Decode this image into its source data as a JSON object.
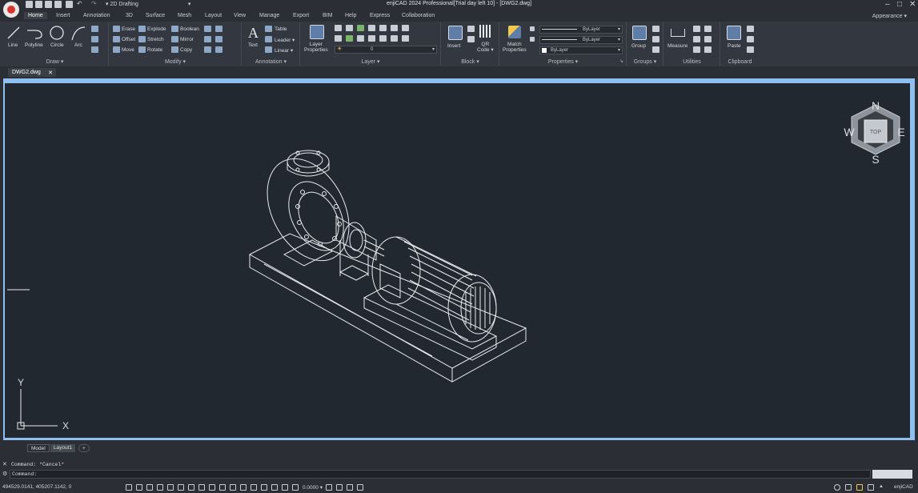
{
  "window": {
    "title": "enjiCAD 2024 Professional[Trial day left 10] - [DWG2.dwg]",
    "workspace": "2D Drafting",
    "appearance": "Appearance"
  },
  "menu_tabs": [
    "Home",
    "Insert",
    "Annotation",
    "3D",
    "Surface",
    "Mesh",
    "Layout",
    "View",
    "Manage",
    "Export",
    "BIM",
    "Help",
    "Express",
    "Collaboration"
  ],
  "ribbon": {
    "draw": {
      "label": "Draw",
      "tools": [
        "Line",
        "Polyline",
        "Circle",
        "Arc"
      ]
    },
    "modify": {
      "label": "Modify",
      "rows": [
        [
          "Erase",
          "Explode",
          "Boolean"
        ],
        [
          "Offset",
          "Stretch",
          "Mirror"
        ],
        [
          "Move",
          "Rotate",
          "Copy"
        ]
      ]
    },
    "annotation": {
      "label": "Annotation",
      "text": "Text",
      "table": "Table",
      "leader": "Leader",
      "linear": "Linear"
    },
    "layer": {
      "label": "Layer",
      "layer_properties": "Layer Properties",
      "current_layer": "0"
    },
    "block": {
      "label": "Block",
      "insert": "Insert",
      "qr_code": "QR Code"
    },
    "properties": {
      "label": "Properties",
      "match": "Match Properties",
      "color": "ByLayer",
      "linetype": "ByLayer",
      "lineweight": "ByLayer"
    },
    "groups": {
      "label": "Groups",
      "group": "Group"
    },
    "utilities": {
      "label": "Utilities",
      "measure": "Measure"
    },
    "clipboard": {
      "label": "Clipboard",
      "paste": "Paste"
    }
  },
  "document_tab": "DWG2.dwg",
  "viewcube": {
    "top": "TOP",
    "n": "N",
    "s": "S",
    "e": "E",
    "w": "W"
  },
  "ucs": {
    "x": "X",
    "y": "Y"
  },
  "layout_tabs": {
    "model": "Model",
    "layout1": "Layout1",
    "add": "+"
  },
  "command": {
    "history": "Command: *Cancel*",
    "prompt": "Command:"
  },
  "status": {
    "coordinates": "494529.0141, 405207.1142, 0",
    "scale": "0.0000",
    "app": "enjiCAD"
  }
}
